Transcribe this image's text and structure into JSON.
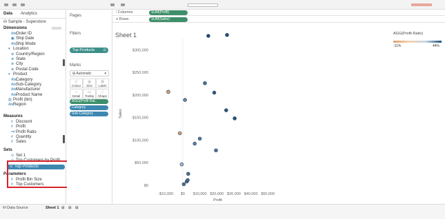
{
  "left": {
    "tab_data": "Data",
    "tab_analytics": "Analytics",
    "datasource": "Sample - Superstore",
    "dimensions_title": "Dimensions",
    "dimensions": [
      {
        "label": "Order ID",
        "glyph": "Abc",
        "indent": 1
      },
      {
        "label": "Ship Date",
        "glyph": "▣",
        "indent": 1
      },
      {
        "label": "Ship Mode",
        "glyph": "Abc",
        "indent": 1
      },
      {
        "label": "Location",
        "glyph": "▾",
        "indent": 0
      },
      {
        "label": "Country/Region",
        "glyph": "⊕",
        "indent": 1
      },
      {
        "label": "State",
        "glyph": "⊕",
        "indent": 1
      },
      {
        "label": "City",
        "glyph": "⊕",
        "indent": 1
      },
      {
        "label": "Postal Code",
        "glyph": "⊕",
        "indent": 1
      },
      {
        "label": "Product",
        "glyph": "▾",
        "indent": 0
      },
      {
        "label": "Category",
        "glyph": "Abc",
        "indent": 1
      },
      {
        "label": "Sub-Category",
        "glyph": "Abc",
        "indent": 1
      },
      {
        "label": "Manufacturer",
        "glyph": "Abc",
        "indent": 1
      },
      {
        "label": "Product Name",
        "glyph": "Abc",
        "indent": 1
      },
      {
        "label": "Profit (bin)",
        "glyph": "▥",
        "indent": 0
      },
      {
        "label": "Region",
        "glyph": "Abc",
        "indent": 0
      }
    ],
    "measures_title": "Measures",
    "measures": [
      {
        "label": "Discount",
        "glyph": "#"
      },
      {
        "label": "Profit",
        "glyph": "#"
      },
      {
        "label": "Profit Ratio",
        "glyph": "=#"
      },
      {
        "label": "Quantity",
        "glyph": "#"
      },
      {
        "label": "Sales",
        "glyph": "#"
      }
    ],
    "sets_title": "Sets",
    "sets": [
      {
        "label": "Set 1",
        "glyph": "⊙",
        "selected": false
      },
      {
        "label": "Top Customers by Profit",
        "glyph": "⊙",
        "selected": false
      },
      {
        "label": "Top Products",
        "glyph": "⊙",
        "selected": true
      }
    ],
    "parameters_title": "Parameters",
    "parameters": [
      {
        "label": "Profit Bin Size",
        "glyph": "#"
      },
      {
        "label": "Top Customers",
        "glyph": "#"
      }
    ]
  },
  "mid": {
    "pages_label": "Pages",
    "filters_label": "Filters",
    "filter_pill": "Top Products",
    "marks_label": "Marks",
    "marks_type": "Automatic",
    "marks_buttons": [
      {
        "label": "Colour",
        "icon": "⁝⁝"
      },
      {
        "label": "Size",
        "icon": "◎"
      },
      {
        "label": "Label",
        "icon": "⊡"
      },
      {
        "label": "Detail",
        "icon": "∴"
      },
      {
        "label": "Tooltip",
        "icon": "▭"
      },
      {
        "label": "Shape",
        "icon": "⁛"
      }
    ],
    "marks_pills": [
      {
        "label": "AGG(Profit Rat..",
        "color": "#3d8f6a"
      },
      {
        "label": "Category",
        "color": "#3d87b0"
      },
      {
        "label": "Sub-Category",
        "color": "#3d87b0"
      }
    ]
  },
  "shelves": {
    "columns_label": "Columns",
    "columns_pill": "SUM(Profit)",
    "rows_label": "Rows",
    "rows_pill": "SUM(Sales)"
  },
  "sheet": {
    "title": "Sheet 1"
  },
  "legend": {
    "title": "AGG(Profit Ratio)",
    "min_label": "-11%",
    "max_label": "44%"
  },
  "bottom": {
    "datasource_tab": "Data Source",
    "sheet_tab": "Sheet 1"
  },
  "colors": {
    "accent_pill": "#3d87b0",
    "filter_pill": "#3d8f8a",
    "shelf_pill": "#3d8f6a",
    "highlight_box": "#d8202a"
  },
  "chart_data": {
    "type": "scatter",
    "xlabel": "Profit",
    "ylabel": "Sales",
    "xlim": [
      -17000,
      58000
    ],
    "ylim": [
      -8000,
      325000
    ],
    "x_ticks": [
      -10000,
      0,
      10000,
      20000,
      30000,
      40000,
      50000
    ],
    "x_tick_labels": [
      "-$10,000",
      "$0",
      "$10,000",
      "$20,000",
      "$30,000",
      "$40,000",
      "$50,000"
    ],
    "y_ticks": [
      0,
      50000,
      100000,
      150000,
      200000,
      250000,
      300000
    ],
    "y_tick_labels": [
      "$0",
      "$50,000",
      "$100,000",
      "$150,000",
      "$200,000",
      "$250,000",
      "$300,000"
    ],
    "grid": false,
    "points": [
      {
        "x": -8500,
        "y": 207000,
        "ratio": -0.11
      },
      {
        "x": -1700,
        "y": 115000,
        "ratio": -0.02
      },
      {
        "x": -600,
        "y": 46000,
        "ratio": 0.0
      },
      {
        "x": 600,
        "y": 2000,
        "ratio": 0.3
      },
      {
        "x": 2300,
        "y": 8000,
        "ratio": 0.3
      },
      {
        "x": 2900,
        "y": 11000,
        "ratio": 0.33
      },
      {
        "x": 3200,
        "y": 25000,
        "ratio": 0.3
      },
      {
        "x": 1300,
        "y": 189000,
        "ratio": 0.2
      },
      {
        "x": 7000,
        "y": 92000,
        "ratio": 0.22
      },
      {
        "x": 10000,
        "y": 103000,
        "ratio": 0.25
      },
      {
        "x": 13000,
        "y": 226000,
        "ratio": 0.3
      },
      {
        "x": 15000,
        "y": 331000,
        "ratio": 0.44
      },
      {
        "x": 18500,
        "y": 205000,
        "ratio": 0.38
      },
      {
        "x": 19500,
        "y": 77000,
        "ratio": 0.28
      },
      {
        "x": 25500,
        "y": 166000,
        "ratio": 0.4
      },
      {
        "x": 26000,
        "y": 333000,
        "ratio": 0.44
      },
      {
        "x": 30500,
        "y": 148000,
        "ratio": 0.42
      }
    ]
  }
}
